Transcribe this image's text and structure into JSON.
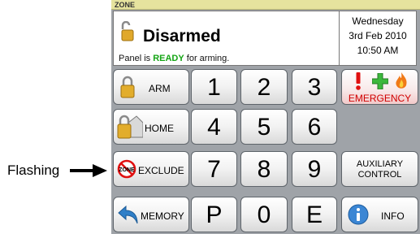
{
  "zone_bar": {
    "label": "ZONE"
  },
  "status": {
    "title": "Disarmed",
    "panel_msg_prefix": "Panel is",
    "panel_msg_ready": "READY",
    "panel_msg_suffix": "for arming.",
    "day": "Wednesday",
    "date": "3rd Feb 2010",
    "time": "10:50 AM"
  },
  "buttons": {
    "arm": "ARM",
    "home": "HOME",
    "exclude": "EXCLUDE",
    "exclude_icon_text": "ZONE",
    "memory": "MEMORY",
    "emergency": "EMERGENCY",
    "auxiliary_line1": "AUXILIARY",
    "auxiliary_line2": "CONTROL",
    "info": "INFO"
  },
  "keypad": {
    "k1": "1",
    "k2": "2",
    "k3": "3",
    "k4": "4",
    "k5": "5",
    "k6": "6",
    "k7": "7",
    "k8": "8",
    "k9": "9",
    "kP": "P",
    "k0": "0",
    "kE": "E"
  },
  "annotation": {
    "label": "Flashing"
  },
  "colors": {
    "ready_green": "#15a515",
    "emergency_red": "#d00000",
    "zone_bar_yellow": "#e6e39e",
    "panel_gray": "#9fa3a8"
  },
  "icons": {
    "status": "lock-open-icon",
    "arm": "padlock-icon",
    "home": "padlock-house-icon",
    "exclude": "no-entry-icon",
    "memory": "back-arrow-icon",
    "emergency": [
      "exclamation-icon",
      "medical-cross-icon",
      "fire-icon"
    ],
    "info": "info-icon"
  }
}
